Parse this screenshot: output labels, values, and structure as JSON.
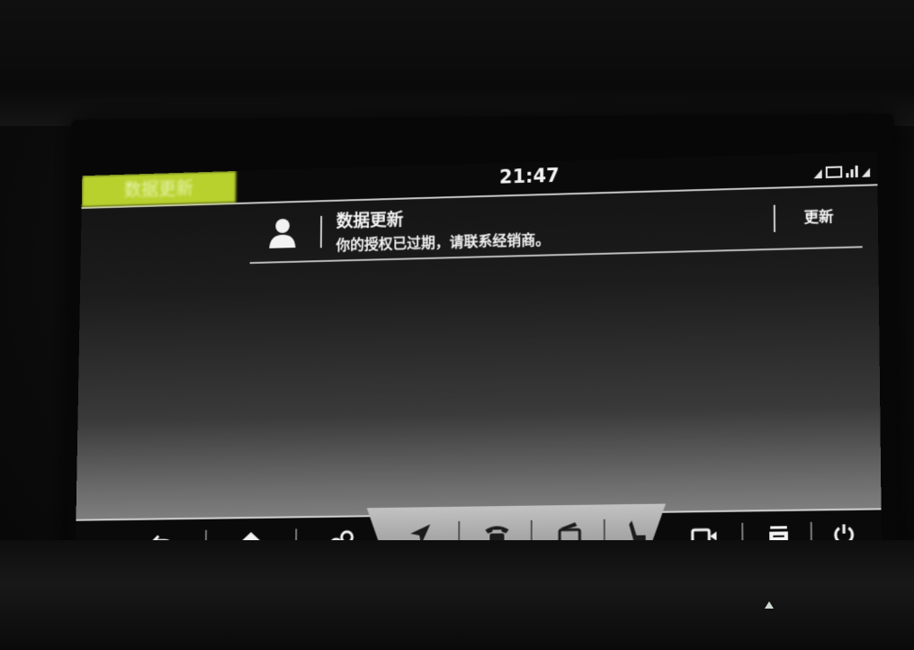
{
  "status_bar": {
    "source_label": "数据更新",
    "time": "21:47"
  },
  "notification": {
    "title": "数据更新",
    "message": "你的授权已过期，请联系经销商。",
    "action_label": "更新"
  },
  "colors": {
    "accent": "#b8d12d",
    "bar_background": "#0a0a0a",
    "active_tab": "#a8a8a8"
  },
  "nav": {
    "buttons": [
      {
        "name": "back-icon",
        "glyph": "⮌"
      },
      {
        "name": "home-icon",
        "glyph": "⌂"
      },
      {
        "name": "apps-icon",
        "glyph": "∞"
      },
      {
        "name": "navigation-icon",
        "glyph": "➤"
      },
      {
        "name": "phone-icon",
        "glyph": "☎"
      },
      {
        "name": "media-icon",
        "glyph": "▣"
      },
      {
        "name": "seat-icon",
        "glyph": "⑂"
      },
      {
        "name": "camera-icon",
        "glyph": "▭"
      },
      {
        "name": "climate-icon",
        "glyph": "▤"
      },
      {
        "name": "power-icon",
        "glyph": "⏻"
      }
    ]
  }
}
